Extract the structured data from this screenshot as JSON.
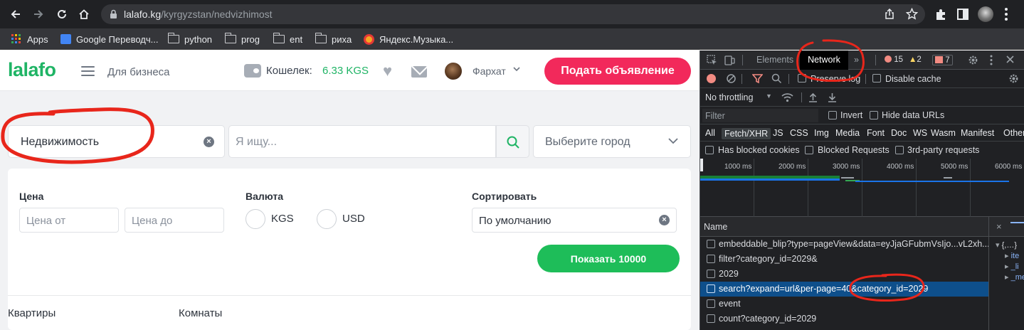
{
  "browser": {
    "url_host": "lalafo.kg",
    "url_path": "/kyrgyzstan/nedvizhimost",
    "bookmarks": [
      "Apps",
      "Google Переводч...",
      "python",
      "prog",
      "ent",
      "рихa",
      "Яндекс.Музыка..."
    ]
  },
  "site": {
    "logo": "lalafo",
    "business_link": "Для бизнеса",
    "wallet_label": "Кошелек:",
    "wallet_value": "6.33 KGS",
    "username": "Фархат",
    "post_button": "Подать объявление",
    "category_value": "Недвижимость",
    "search_placeholder": "Я ищу...",
    "city_placeholder": "Выберите город",
    "filters": {
      "price_label": "Цена",
      "price_from": "Цена от",
      "price_to": "Цена до",
      "currency_label": "Валюта",
      "currency_kgs": "KGS",
      "currency_usd": "USD",
      "sort_label": "Сортировать",
      "sort_value": "По умолчанию",
      "show_button": "Показать 10000"
    },
    "subcategories": [
      "Квартиры",
      "Комнаты"
    ]
  },
  "devtools": {
    "tabs": [
      "Elements",
      "Network"
    ],
    "active_tab": "Network",
    "errors": "15",
    "warnings": "2",
    "issues": "7",
    "preserve_log": "Preserve log",
    "disable_cache": "Disable cache",
    "throttling": "No throttling",
    "filter_placeholder": "Filter",
    "invert": "Invert",
    "hide_data_urls": "Hide data URLs",
    "filter_types": [
      "All",
      "Fetch/XHR",
      "JS",
      "CSS",
      "Img",
      "Media",
      "Font",
      "Doc",
      "WS",
      "Wasm",
      "Manifest",
      "Other"
    ],
    "active_filter": "Fetch/XHR",
    "has_blocked_cookies": "Has blocked cookies",
    "blocked_requests": "Blocked Requests",
    "third_party": "3rd-party requests",
    "timeline_ticks": [
      "1000 ms",
      "2000 ms",
      "3000 ms",
      "4000 ms",
      "5000 ms",
      "6000 ms"
    ],
    "name_column": "Name",
    "requests": [
      "embeddable_blip?type=pageView&data=eyJjaGFubmVsIjo...vL2xh...",
      "filter?category_id=2029&",
      "2029",
      "search?expand=url&per-page=40&category_id=2029",
      "event",
      "count?category_id=2029"
    ],
    "selected_request": "search?expand=url&per-page=40&category_id=2029",
    "preview_lines": [
      "{,…}",
      "ite",
      "_li",
      "_me"
    ]
  },
  "colors": {
    "brand_green": "#1fb465",
    "brand_pink": "#f2295b",
    "show_green": "#1ebd59",
    "annotation_red": "#e8261b"
  }
}
